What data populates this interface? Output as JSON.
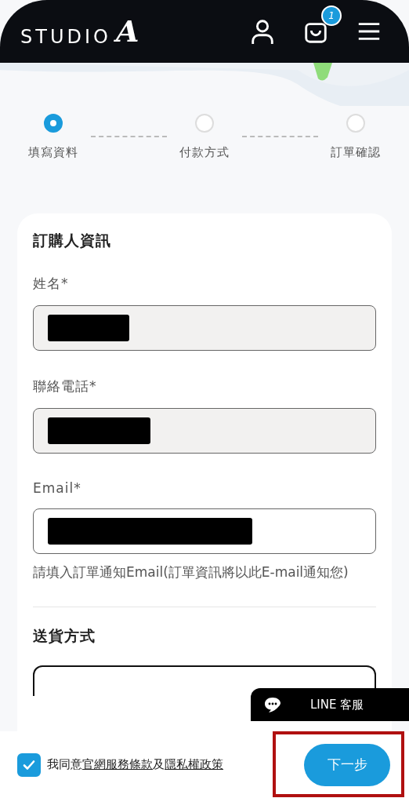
{
  "header": {
    "logo_text": "STUDIO",
    "logo_mark": "A",
    "cart_count": "1"
  },
  "steps": [
    {
      "label": "填寫資料",
      "selected": true
    },
    {
      "label": "付款方式",
      "selected": false
    },
    {
      "label": "訂單確認",
      "selected": false
    }
  ],
  "buyer_section": {
    "title": "訂購人資訊",
    "fields": [
      {
        "label": "姓名*",
        "redacted": true,
        "disabled": true
      },
      {
        "label": "聯絡電話*",
        "redacted": true,
        "disabled": true
      },
      {
        "label": "Email*",
        "redacted": true,
        "disabled": false,
        "hint": "請填入訂單通知Email(訂單資訊將以此E-mail通知您)"
      }
    ]
  },
  "shipping_section": {
    "title": "送貨方式"
  },
  "line_chat": {
    "label": "LINE 客服"
  },
  "footer": {
    "agree_checked": true,
    "agree_prefix": "我同意",
    "terms_link": "官網服務條款",
    "joiner": "及",
    "privacy_link": "隱私權政策",
    "next_button": "下一步",
    "next_highlighted": true
  }
}
